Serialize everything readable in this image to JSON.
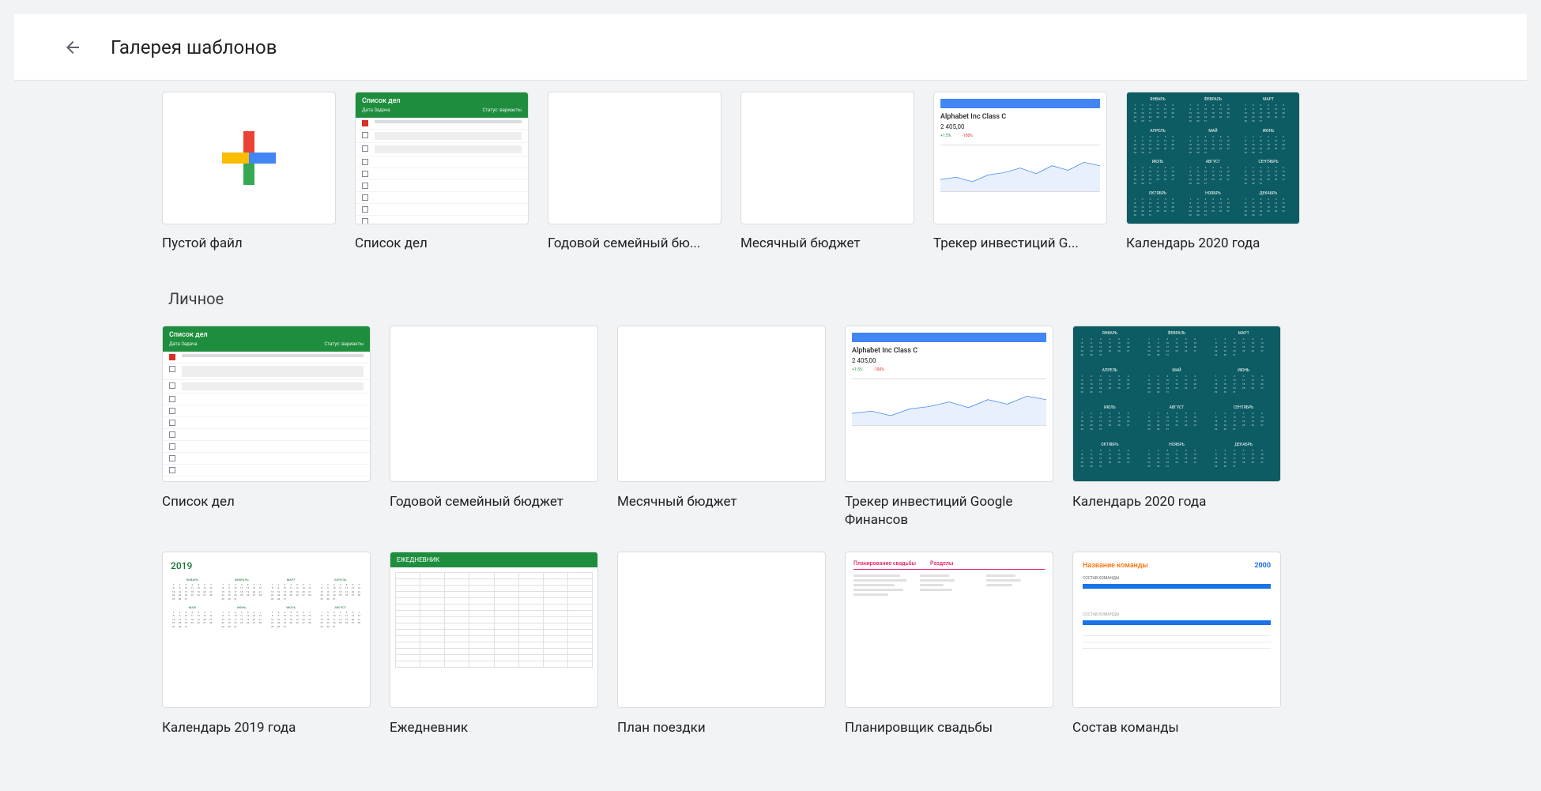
{
  "header": {
    "title": "Галерея шаблонов"
  },
  "row1": [
    {
      "label": "Пустой файл",
      "kind": "blank"
    },
    {
      "label": "Список дел",
      "kind": "todo"
    },
    {
      "label": "Годовой семейный бю...",
      "kind": "blankimg"
    },
    {
      "label": "Месячный бюджет",
      "kind": "blankimg"
    },
    {
      "label": "Трекер инвестиций G...",
      "kind": "tracker"
    },
    {
      "label": "Календарь 2020 года",
      "kind": "cal2020"
    }
  ],
  "section_personal": "Личное",
  "row2": [
    {
      "label": "Список дел",
      "kind": "todo"
    },
    {
      "label": "Годовой семейный бюджет",
      "kind": "blankimg"
    },
    {
      "label": "Месячный бюджет",
      "kind": "blankimg"
    },
    {
      "label": "Трекер инвестиций Google Финансов",
      "kind": "tracker"
    },
    {
      "label": "Календарь 2020 года",
      "kind": "cal2020"
    }
  ],
  "row3": [
    {
      "label": "Календарь 2019 года",
      "kind": "cal2019"
    },
    {
      "label": "Ежедневник",
      "kind": "planner"
    },
    {
      "label": "План поездки",
      "kind": "blankimg"
    },
    {
      "label": "Планировщик свадьбы",
      "kind": "wedding"
    },
    {
      "label": "Состав команды",
      "kind": "team"
    }
  ],
  "todo_thumb": {
    "title": "Список дел",
    "meta": "Дата Задача",
    "status": "Статус: варианты"
  },
  "tracker_thumb": {
    "name": "Alphabet Inc Class C",
    "value": "2 405,00"
  },
  "cal19_year": "2019",
  "cal19_months": [
    "ЯНВАРЬ",
    "ФЕВРАЛЬ",
    "МАРТ",
    "АПРЕЛЬ",
    "МАЙ",
    "ИЮНЬ",
    "ИЮЛЬ",
    "АВГУСТ"
  ],
  "cal20_months": [
    "ЯНВАРЬ",
    "ФЕВРАЛЬ",
    "МАРТ",
    "АПРЕЛЬ",
    "МАЙ",
    "ИЮНЬ",
    "ИЮЛЬ",
    "АВГУСТ",
    "СЕНТЯБРЬ",
    "ОКТЯБРЬ",
    "НОЯБРЬ",
    "ДЕКАБРЬ"
  ],
  "planner_title": "ЕЖЕДНЕВНИК",
  "wedding": {
    "t1": "Планирование свадьбы",
    "t2": "Разделы"
  },
  "team": {
    "name": "Название команды",
    "year": "2000",
    "sub": "СОСТАВ КОМАНДЫ"
  }
}
